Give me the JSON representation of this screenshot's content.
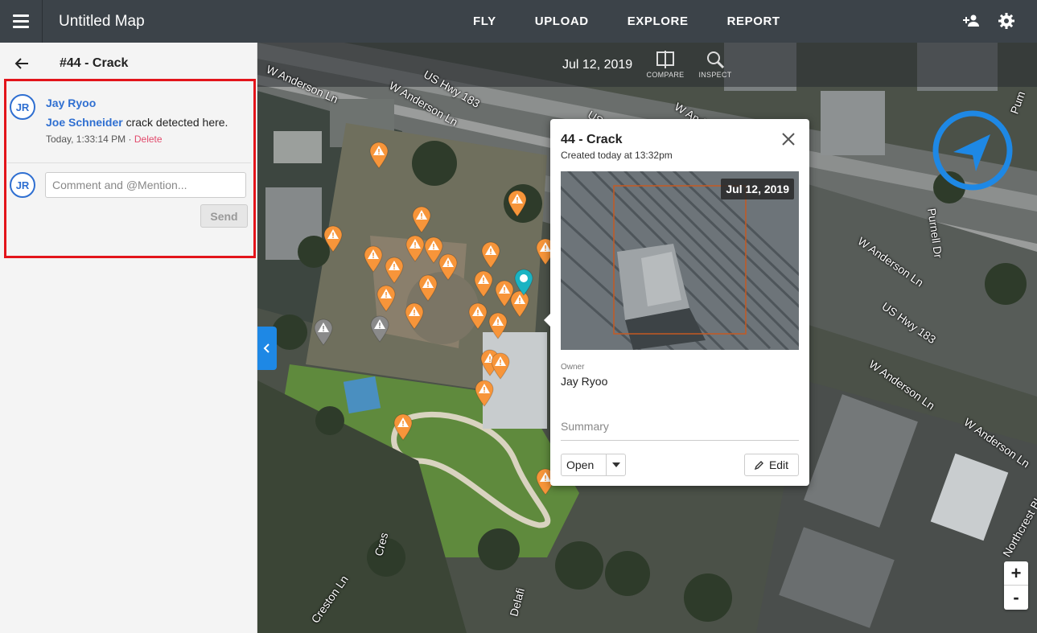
{
  "topbar": {
    "title": "Untitled Map",
    "nav": [
      "FLY",
      "UPLOAD",
      "EXPLORE",
      "REPORT"
    ],
    "icons": [
      "menu-icon",
      "add-user-icon",
      "gear-icon"
    ]
  },
  "sidebar": {
    "title": "#44 - Crack",
    "comment": {
      "initials": "JR",
      "author": "Jay Ryoo",
      "mention": "Joe Schneider",
      "text": " crack detected here.",
      "timestamp": "Today, 1:33:14 PM",
      "separator": "·",
      "delete_label": "Delete"
    },
    "new_comment": {
      "initials": "JR",
      "placeholder": "Comment and @Mention...",
      "send_label": "Send"
    }
  },
  "map": {
    "date": "Jul 12, 2019",
    "tools": [
      {
        "label": "COMPARE",
        "icon": "compare-icon"
      },
      {
        "label": "INSPECT",
        "icon": "inspect-icon"
      }
    ],
    "streets": [
      "W Anderson Ln",
      "US Hwy 183",
      "W Anderson Ln",
      "US Hwy",
      "W Anderson Ln",
      "Purnell Dr",
      "W Anderson Ln",
      "US Hwy 183",
      "W Anderson Ln",
      "W Anderson Ln",
      "Creston Ln",
      "Delafi",
      "Cres",
      "Northcrest Bl",
      "Pum"
    ],
    "zoom": {
      "in": "+",
      "out": "-"
    },
    "colors": {
      "issue_pin": "#f7953a",
      "closed_pin": "#8a8a8a",
      "selected_pin": "#1bb3c2",
      "compass": "#1e88e5"
    }
  },
  "popup": {
    "title": "44 - Crack",
    "subtitle": "Created today at 13:32pm",
    "photo_date": "Jul 12, 2019",
    "owner_label": "Owner",
    "owner": "Jay Ryoo",
    "summary_placeholder": "Summary",
    "status": "Open",
    "edit_label": "Edit"
  }
}
